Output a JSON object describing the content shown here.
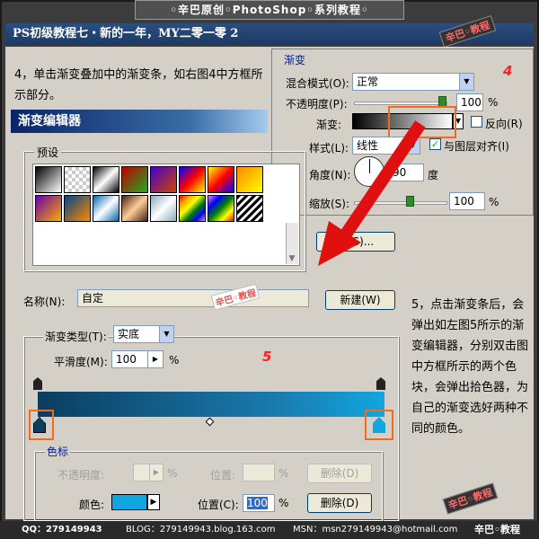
{
  "header": {
    "top_title": "◦辛巴原创◦PhotoShop◦系列教程◦",
    "tutorial_title": "PS初级教程七・新的一年，MY二零一零 2",
    "watermark": "辛巴◦教程"
  },
  "step4": {
    "text": "4，单击渐变叠加中的渐变条，如右图4中方框所示部分。",
    "marker": "4"
  },
  "gradient_editor": {
    "title": "渐变编辑器",
    "presets_label": "预设",
    "name_label": "名称(N):",
    "name_value": "自定",
    "new_button": "新建(W)",
    "save_button": "储(S)...",
    "gradient_type_label": "渐变类型(T):",
    "gradient_type_value": "实底",
    "smoothness_label": "平滑度(M):",
    "smoothness_value": "100",
    "percent": "%",
    "marker": "5",
    "color_stops_label": "色标",
    "opacity_label": "不透明度:",
    "location_label": "位置:",
    "delete_button": "删除(D)",
    "color_label": "颜色:",
    "location_c_label": "位置(C):",
    "location_c_value": "100"
  },
  "gradient_overlay": {
    "section": "渐变",
    "blend_mode_label": "混合模式(O):",
    "blend_mode_value": "正常",
    "opacity_label": "不透明度(P):",
    "opacity_value": "100",
    "gradient_label": "渐变:",
    "reverse_label": "反向(R)",
    "style_label": "样式(L):",
    "style_value": "线性",
    "align_label": "与图层对齐(I)",
    "angle_label": "角度(N):",
    "angle_value": "90",
    "angle_unit": "度",
    "scale_label": "缩放(S):",
    "scale_value": "100",
    "percent": "%"
  },
  "step5": {
    "text": "5，点击渐变条后，会弹出如左图5所示的渐变编辑器，分别双击图中方框所示的两个色块，会弹出拾色器，为自己的渐变选好两种不同的颜色。"
  },
  "footer": {
    "qq": "QQ：279149943",
    "blog": "BLOG：279149943.blog.163.com",
    "msn": "MSN：msn279149943@hotmail.com",
    "logo": "辛巴◦教程"
  },
  "colors": {
    "accent_orange": "#f26a1f",
    "marker_red": "#ff2020",
    "stop_color": "#11a6e0",
    "gradient_dark": "#0b3d60"
  }
}
